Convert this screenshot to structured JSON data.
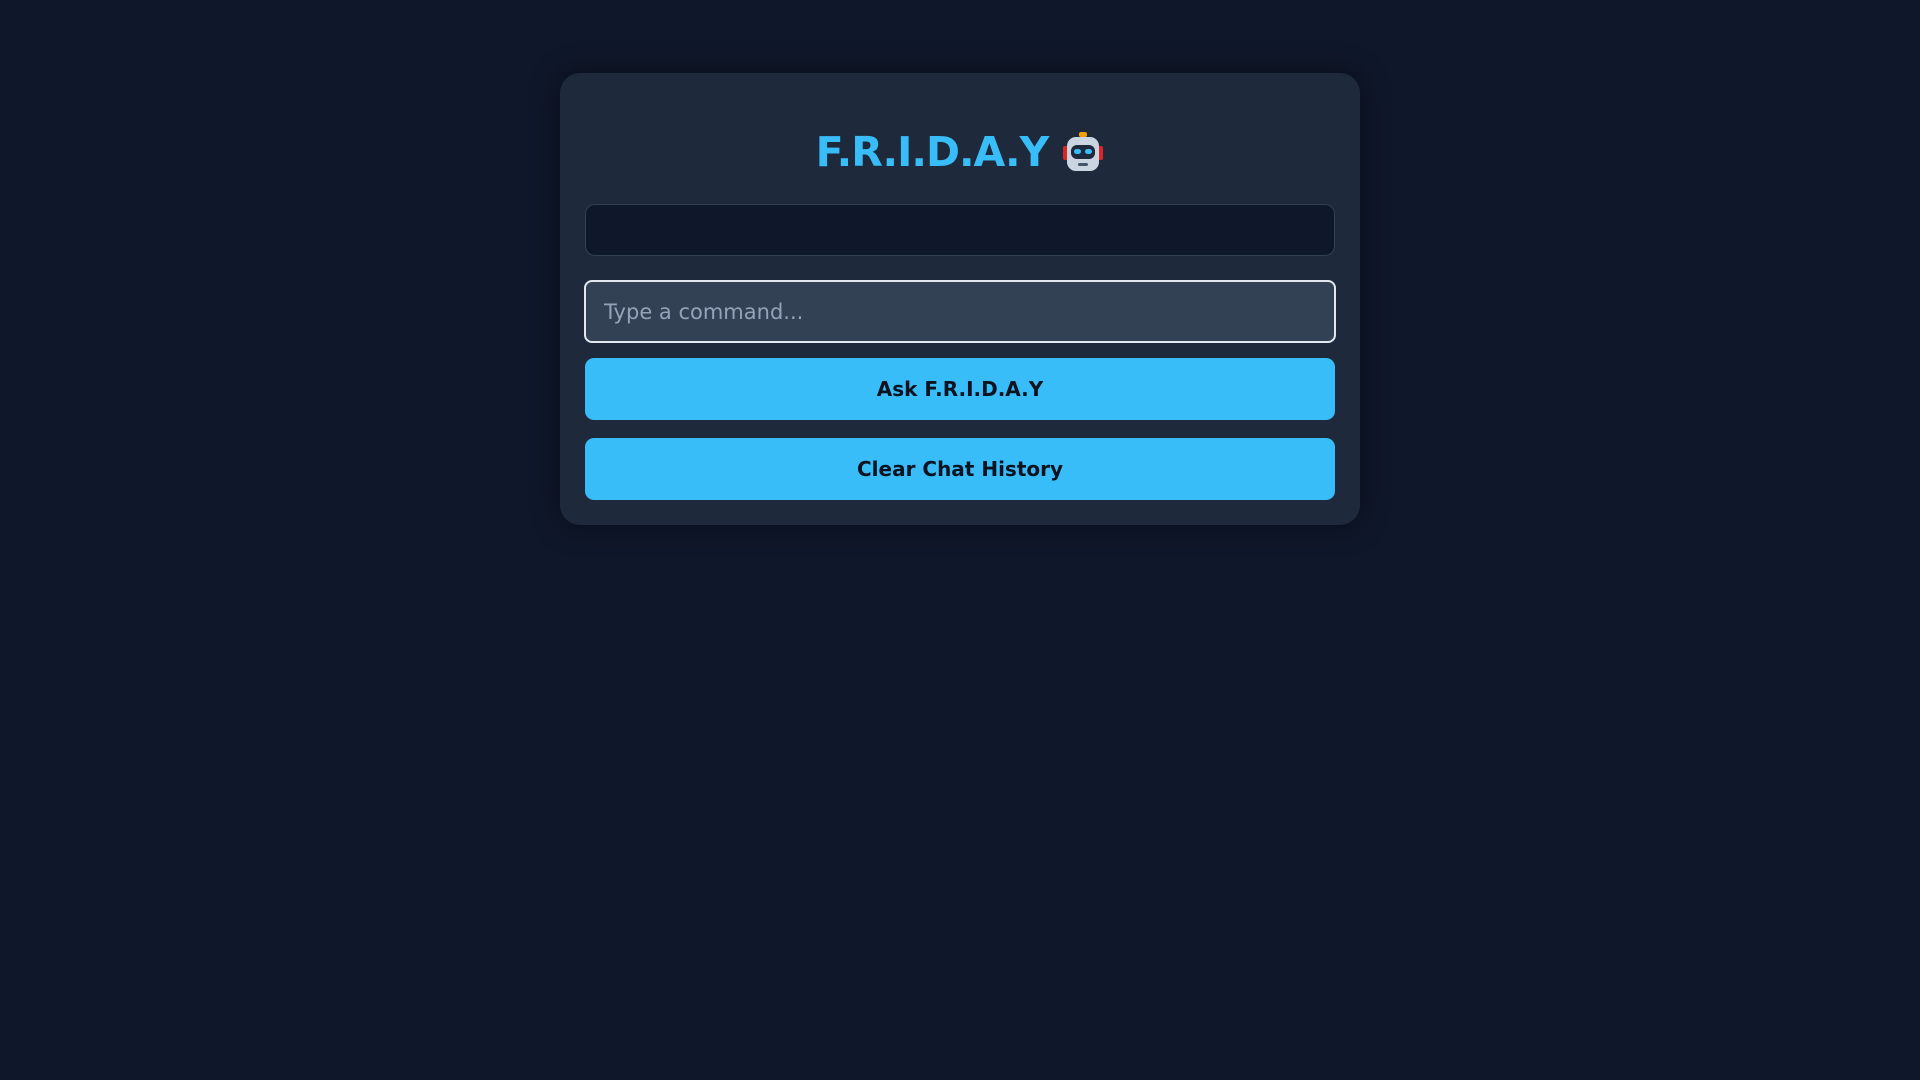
{
  "app": {
    "title": "F.R.I.D.A.Y",
    "title_icon": "robot-icon"
  },
  "chat": {
    "history_text": ""
  },
  "command": {
    "value": "",
    "placeholder": "Type a command..."
  },
  "buttons": {
    "ask_label": "Ask F.R.I.D.A.Y",
    "clear_label": "Clear Chat History"
  },
  "colors": {
    "background": "#0f172a",
    "card": "#1e293b",
    "accent": "#38bdf8",
    "input": "#334155"
  }
}
